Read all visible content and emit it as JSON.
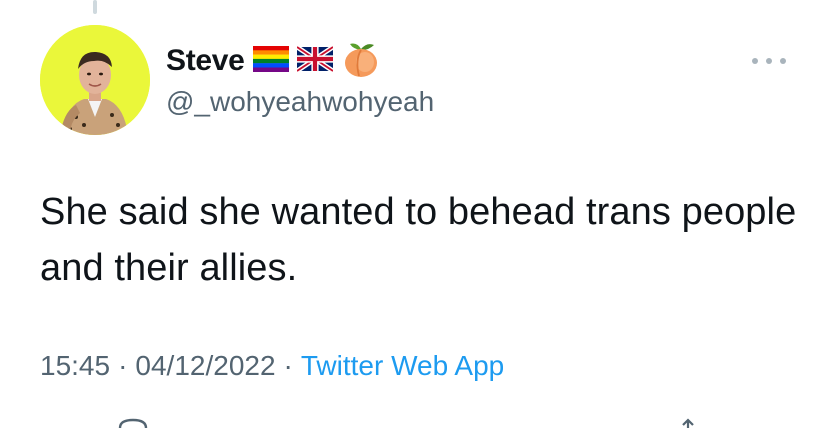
{
  "tweet": {
    "author": {
      "name": "Steve",
      "handle": "@_wohyeahwohyeah",
      "name_emojis": [
        "rainbow-flag-icon",
        "uk-flag-icon",
        "peach-icon"
      ],
      "avatar_bg": "#eaf73a"
    },
    "text": "She said she wanted to behead trans people and their allies.",
    "time": "15:45",
    "separator": "·",
    "date": "04/12/2022",
    "source": "Twitter Web App"
  },
  "colors": {
    "text_primary": "#0f1419",
    "text_secondary": "#536471",
    "link": "#1d9bf0"
  }
}
